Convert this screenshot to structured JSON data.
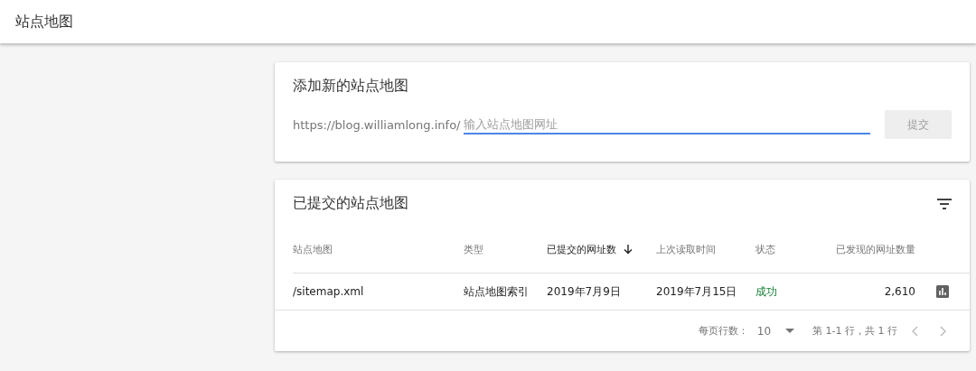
{
  "header": {
    "title": "站点地图"
  },
  "add_card": {
    "title": "添加新的站点地图",
    "prefix": "https://blog.williamlong.info/",
    "input": {
      "placeholder": "输入站点地图网址"
    },
    "submit": {
      "label": "提交",
      "disabled": true
    }
  },
  "submitted_card": {
    "title": "已提交的站点地图",
    "columns": [
      {
        "label": "站点地图",
        "sorted": false
      },
      {
        "label": "类型",
        "sorted": false
      },
      {
        "label": "已提交的网址数",
        "sorted": true
      },
      {
        "label": "上次读取时间",
        "sorted": false
      },
      {
        "label": "状态",
        "sorted": false
      },
      {
        "label": "已发现的网址数量",
        "sorted": false
      }
    ],
    "rows": [
      {
        "sitemap": "/sitemap.xml",
        "type": "站点地图索引",
        "submitted": "2019年7月9日",
        "last_read": "2019年7月15日",
        "status": {
          "text": "成功",
          "kind": "success"
        },
        "discovered": "2,610"
      }
    ],
    "pagination": {
      "rows_per_page_label": "每页行数：",
      "rows_per_page": "10",
      "range": "第 1-1 行，共 1 行",
      "prev": {
        "disabled": true
      },
      "next": {
        "disabled": true
      }
    }
  }
}
